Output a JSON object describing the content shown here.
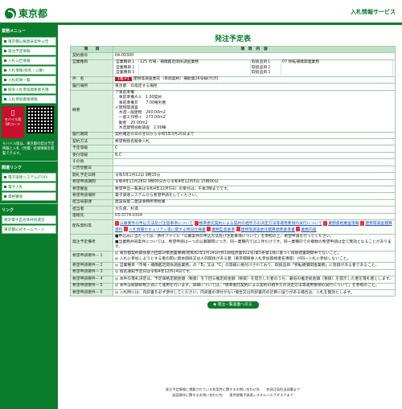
{
  "header": {
    "logo_text": "東京都",
    "system_name": "入札情報サービス"
  },
  "sidebar": {
    "main_menu_heading": "業務メニュー",
    "items": [
      {
        "label": "東京都公報発表案件公告"
      },
      {
        "label": "発注予定情報"
      },
      {
        "label": "入札公告情報"
      },
      {
        "label": "入札情報(指名・公募)"
      },
      {
        "label": "入札結果一覧"
      },
      {
        "label": "競争入札参加資格者名簿"
      },
      {
        "label": "入札参加資格情報"
      }
    ],
    "mobile_label": "モバイル版",
    "mobile_sub": "QRコード",
    "mobile_note": "モバイル版は、東京都の発注予定情報と入札（見積）結果情報を閲覧できます。",
    "links_heading": "関連リンク",
    "links": [
      {
        "label": "電子調達システム(TOP)"
      },
      {
        "label": "電子入札"
      },
      {
        "label": "資格審査"
      }
    ],
    "links2_heading": "リンク",
    "links2": [
      {
        "label": "東京電子自治体共同運営"
      },
      {
        "label": "東京都公式ホームページ"
      }
    ]
  },
  "main": {
    "title": "発注予定表",
    "col_item": "項　　目",
    "col_content": "項　目　内　容",
    "rows": {
      "contract_no": {
        "label": "契約番号",
        "value": "04-00300"
      },
      "business_type": {
        "label": "営業種目",
        "v1": "営業種目１",
        "v2": "125 市場・補償鑑定関係調査業務",
        "v3": "営業種目２",
        "v4": "営業種目３",
        "c1": "取扱品目１",
        "c2": "07 移転補償関連業務",
        "c3": "取扱品目２",
        "c4": "取扱品目３"
      },
      "subject": {
        "label": "件　名",
        "tag": "【電子】",
        "value": "建物等調査委託（単価契約）補助第26号線(代沢)"
      },
      "place": {
        "label": "履行場所",
        "value": "東京都　の指定する場所"
      },
      "overview": {
        "label": "概要",
        "lines": [
          "ア事前準備",
          "　事前準備Ａ①　1.00契約",
          "　事前準備Ｂ　　7.00権利者",
          "イ建物等調査",
          "　木造一般建物　260.00m2",
          "　一般工作物イ　273.00m2",
          "　動産　20.00m2",
          "　木造建物協助調査　2.00棟"
        ]
      },
      "period": {
        "label": "履行期間",
        "value": "契約確定の日の翌日から令和5年3月20日まで"
      },
      "method": {
        "label": "契約方法",
        "value": "希望制指名競争入札"
      },
      "rank": {
        "label": "予定等級",
        "value": "C"
      },
      "accept": {
        "label": "受付等級",
        "value": "B,C"
      },
      "other": {
        "label": "その他",
        "value": ""
      },
      "jv": {
        "label": "公告登載日",
        "value": ""
      },
      "open_date": {
        "label": "開札予定日時",
        "value": "令和5年1月12日 9時15分"
      },
      "apply_period": {
        "label": "希望申請期間",
        "value": "令和4年11月28日 9時00分から令和4年12月5日 15時00分"
      },
      "apply_note": {
        "label": "希望審査",
        "value": "希望申出一覧表は令和4年12月5日）の受付は、午後3時までです。"
      },
      "apply_method": {
        "label": "希望申請場所",
        "value": "電子調達システムから希望申請をしてください。"
      },
      "dept": {
        "label": "担当局部課",
        "value": "建設局第二建設事務所用地課"
      },
      "person": {
        "label": "担当者",
        "value": "大久保、杉浦"
      },
      "tel": {
        "label": "連絡先",
        "value": "03-3774-0314"
      },
      "docs": {
        "label": "配布資料等",
        "items": [
          "公募要件の申込方法及び注意事項について",
          "標準委託契約による契約の相手方の決定方法等運用要領の試行について",
          "業務資格審査情報",
          "建物等調査積算資料",
          "入札情報セキュリティ等に関する特記仕様書",
          "業務監督基準",
          "建物等調査委託積算標準基準書",
          "業務内容"
        ]
      },
      "notes": {
        "label": "発注予定備考",
        "value": "■申込みに当たっては、添付ファイル「公募案件の申込方法及び注意事項について」を参照の上、希望申請を行ってください。\n■当業務共同案件については、希望申請は一つの公募期間につき、同一業種内では１件だけです。同一業種内での複数の希望申請は全て無効となることがあります。"
      },
      "cond1": {
        "label": "希望申請要件－１",
        "value": "◎ 東京都契約関係暴力団等対策措置要綱(昭和62年1月14日付61財経庶第922号)第5条第1項に基づく排除措置期間中でないこと。\n◎ 入札に参加しようとする者の間に資本関係又は人的関係がある者（東京都競争入札参加資格者名簿等）が同一入札に参加しないこと。"
      },
      "cond2": {
        "label": "希望申請要件－２",
        "value": "◎ 営業種目「市場・補償鑑定関係調査業務」の「B」又は「C」の等級に格付けされており、取扱品目「移転補償関連業務」に登録がある者であること。"
      },
      "cond3": {
        "label": "希望申請要件－３",
        "value": "◎ 指名通知予定日は令和4年12月14日です。"
      },
      "cond4": {
        "label": "希望申請要件－４",
        "value": "◎ 本件の落札決定は、予定価格定額金額（税抜）を下回る推定総金額（税抜）を提示した者のうち、最低の推定総金額（税抜）を提示した者を落札者とします。"
      },
      "cond5": {
        "label": "希望申請要件－５",
        "value": "◎ 本件は総額抑制方式にて運用を行います。詳細については、「標準委託契約による契約の相手方の決定方法等運用要領の試行について」を参照のこと。"
      },
      "cond6": {
        "label": "希望申請要件－６",
        "value": "◎ 入札時には、内訳書を必ず添付してください。内訳書の添付がない場合又は内訳書内の計算に誤りがある場合は、入札を無効とします。"
      }
    },
    "back_button": "◆ 発注一覧画面へ戻る"
  },
  "footer": {
    "line1": "発注予定情報に掲載されている各案件に関するお問い合わせ先　　各発注局担当部署まで",
    "line2": "画面操作に関するお問い合わせ先　　東京都電子調達システムヘルプデスクまで"
  }
}
